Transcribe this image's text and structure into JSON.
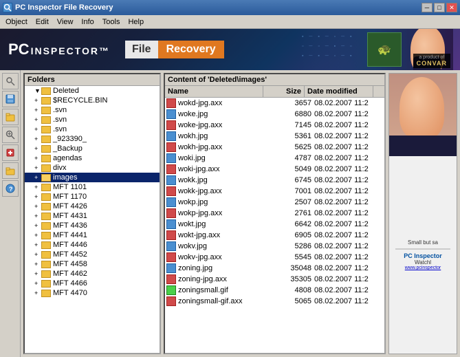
{
  "titlebar": {
    "title": "PC Inspector File Recovery",
    "icon": "🔍",
    "buttons": {
      "minimize": "─",
      "maximize": "□",
      "close": "✕"
    }
  },
  "menubar": {
    "items": [
      {
        "label": "Object"
      },
      {
        "label": "Edit"
      },
      {
        "label": "View"
      },
      {
        "label": "Info"
      },
      {
        "label": "Tools"
      },
      {
        "label": "Help"
      }
    ]
  },
  "header": {
    "logo_pc": "PC",
    "logo_inspector": "INSPECTOR™",
    "file_label": "File",
    "recovery_label": "Recovery",
    "convar_text": "a product of\nCONVAR"
  },
  "folders_panel": {
    "header": "Folders",
    "tree": [
      {
        "level": 0,
        "label": "Deleted",
        "expanded": true,
        "selected": false
      },
      {
        "level": 1,
        "label": "$RECYCLE.BIN",
        "expanded": false,
        "selected": false
      },
      {
        "level": 1,
        "label": ".svn",
        "expanded": false,
        "selected": false
      },
      {
        "level": 1,
        "label": ".svn",
        "expanded": false,
        "selected": false
      },
      {
        "level": 1,
        "label": ".svn",
        "expanded": false,
        "selected": false
      },
      {
        "level": 1,
        "label": "_923390_",
        "expanded": false,
        "selected": false
      },
      {
        "level": 1,
        "label": "_Backup",
        "expanded": false,
        "selected": false
      },
      {
        "level": 1,
        "label": "agendas",
        "expanded": false,
        "selected": false
      },
      {
        "level": 1,
        "label": "divx",
        "expanded": false,
        "selected": false
      },
      {
        "level": 1,
        "label": "images",
        "expanded": false,
        "selected": true
      },
      {
        "level": 1,
        "label": "MFT 1101",
        "expanded": false,
        "selected": false
      },
      {
        "level": 1,
        "label": "MFT 1170",
        "expanded": false,
        "selected": false
      },
      {
        "level": 1,
        "label": "MFT 4426",
        "expanded": false,
        "selected": false
      },
      {
        "level": 1,
        "label": "MFT 4431",
        "expanded": false,
        "selected": false
      },
      {
        "level": 1,
        "label": "MFT 4436",
        "expanded": false,
        "selected": false
      },
      {
        "level": 1,
        "label": "MFT 4441",
        "expanded": false,
        "selected": false
      },
      {
        "level": 1,
        "label": "MFT 4446",
        "expanded": false,
        "selected": false
      },
      {
        "level": 1,
        "label": "MFT 4452",
        "expanded": false,
        "selected": false
      },
      {
        "level": 1,
        "label": "MFT 4458",
        "expanded": false,
        "selected": false
      },
      {
        "level": 1,
        "label": "MFT 4462",
        "expanded": false,
        "selected": false
      },
      {
        "level": 1,
        "label": "MFT 4466",
        "expanded": false,
        "selected": false
      },
      {
        "level": 1,
        "label": "MFT 4470",
        "expanded": false,
        "selected": false
      }
    ]
  },
  "files_panel": {
    "header": "Content of 'Deleted\\images'",
    "columns": {
      "name": "Name",
      "size": "Size",
      "date": "Date modified"
    },
    "files": [
      {
        "name": "wokd-jpg.axx",
        "size": "3657",
        "date": "08.02.2007 11:2",
        "type": "axx"
      },
      {
        "name": "woke.jpg",
        "size": "6880",
        "date": "08.02.2007 11:2",
        "type": "jpg"
      },
      {
        "name": "woke-jpg.axx",
        "size": "7145",
        "date": "08.02.2007 11:2",
        "type": "axx"
      },
      {
        "name": "wokh.jpg",
        "size": "5361",
        "date": "08.02.2007 11:2",
        "type": "jpg"
      },
      {
        "name": "wokh-jpg.axx",
        "size": "5625",
        "date": "08.02.2007 11:2",
        "type": "axx"
      },
      {
        "name": "woki.jpg",
        "size": "4787",
        "date": "08.02.2007 11:2",
        "type": "jpg"
      },
      {
        "name": "woki-jpg.axx",
        "size": "5049",
        "date": "08.02.2007 11:2",
        "type": "axx"
      },
      {
        "name": "wokk.jpg",
        "size": "6745",
        "date": "08.02.2007 11:2",
        "type": "jpg"
      },
      {
        "name": "wokk-jpg.axx",
        "size": "7001",
        "date": "08.02.2007 11:2",
        "type": "axx"
      },
      {
        "name": "wokp.jpg",
        "size": "2507",
        "date": "08.02.2007 11:2",
        "type": "jpg"
      },
      {
        "name": "wokp-jpg.axx",
        "size": "2761",
        "date": "08.02.2007 11:2",
        "type": "axx"
      },
      {
        "name": "wokt.jpg",
        "size": "6642",
        "date": "08.02.2007 11:2",
        "type": "jpg"
      },
      {
        "name": "wokt-jpg.axx",
        "size": "6905",
        "date": "08.02.2007 11:2",
        "type": "axx"
      },
      {
        "name": "wokv.jpg",
        "size": "5286",
        "date": "08.02.2007 11:2",
        "type": "jpg"
      },
      {
        "name": "wokv-jpg.axx",
        "size": "5545",
        "date": "08.02.2007 11:2",
        "type": "axx"
      },
      {
        "name": "zoning.jpg",
        "size": "35048",
        "date": "08.02.2007 11:2",
        "type": "jpg"
      },
      {
        "name": "zoning-jpg.axx",
        "size": "35305",
        "date": "08.02.2007 11:2",
        "type": "axx"
      },
      {
        "name": "zoningsmall.gif",
        "size": "4808",
        "date": "08.02.2007 11:2",
        "type": "gif"
      },
      {
        "name": "zoningsmall-gif.axx",
        "size": "5065",
        "date": "08.02.2007 11:2",
        "type": "axx"
      }
    ]
  },
  "right_panel": {
    "ad_text": "Small but sa",
    "logo": "PC Inspector",
    "watchl_text": "Watchl",
    "url": "www.pcinspector"
  },
  "toolbar": {
    "buttons": [
      {
        "icon": "🔍",
        "name": "search"
      },
      {
        "icon": "💾",
        "name": "save"
      },
      {
        "icon": "📋",
        "name": "clipboard"
      },
      {
        "icon": "🔎",
        "name": "zoom"
      },
      {
        "icon": "➕",
        "name": "add"
      },
      {
        "icon": "📁",
        "name": "folder"
      },
      {
        "icon": "❓",
        "name": "help"
      }
    ]
  }
}
